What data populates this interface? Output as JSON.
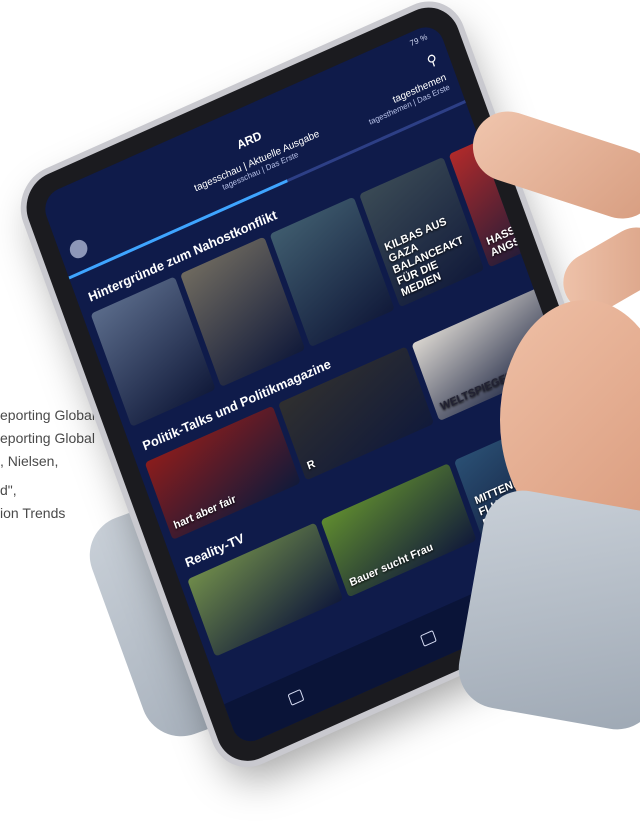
{
  "background_text": [
    "eporting Global",
    "eporting Global",
    ", Nielsen,",
    "d\",",
    "ion Trends"
  ],
  "status_bar": {
    "time": "",
    "battery": "79 %"
  },
  "header": {
    "logo": "ARD",
    "now_playing_title": "tagesschau | Aktuelle Ausgabe",
    "now_playing_channel": "tagesschau | Das Erste",
    "next_title": "tagesthemen",
    "next_channel": "tagesthemen | Das Erste",
    "search_icon": "search-icon"
  },
  "progress_fraction": 0.55,
  "sections": [
    {
      "title": "Hintergründe zum Nahostkonflikt",
      "tiles": [
        {
          "caption": "",
          "color": "#5a6b8a"
        },
        {
          "caption": "",
          "color": "#6f6a5f"
        },
        {
          "caption": "",
          "color": "#3f5c6e"
        },
        {
          "caption": "KILBAS AUS GAZA BALANCEAKT FÜR DIE MEDIEN",
          "color": "#3a4a55"
        },
        {
          "caption": "HASS WUT ANGST",
          "color": "#b12a2a"
        }
      ]
    },
    {
      "title": "Politik-Talks und Politikmagazine",
      "tiles": [
        {
          "caption": "hart aber fair",
          "color": "#8a1c1c"
        },
        {
          "caption": "R",
          "color": "#2f2f2f"
        },
        {
          "caption": "WELTSPIEGEL",
          "color": "#d9d5cf"
        }
      ]
    },
    {
      "title": "Reality-TV",
      "tiles": [
        {
          "caption": "",
          "color": "#6e8a4a"
        },
        {
          "caption": "Bauer sucht Frau",
          "color": "#5f8b2f"
        },
        {
          "caption": "MITTENDRIN FLUGHAFEN FRANKFURT",
          "color": "#2a4f73"
        }
      ]
    }
  ],
  "bottom_nav": [
    {
      "label": "",
      "icon": "home-icon"
    },
    {
      "label": "",
      "icon": "library-icon"
    },
    {
      "label": "",
      "icon": "profile-icon"
    }
  ]
}
